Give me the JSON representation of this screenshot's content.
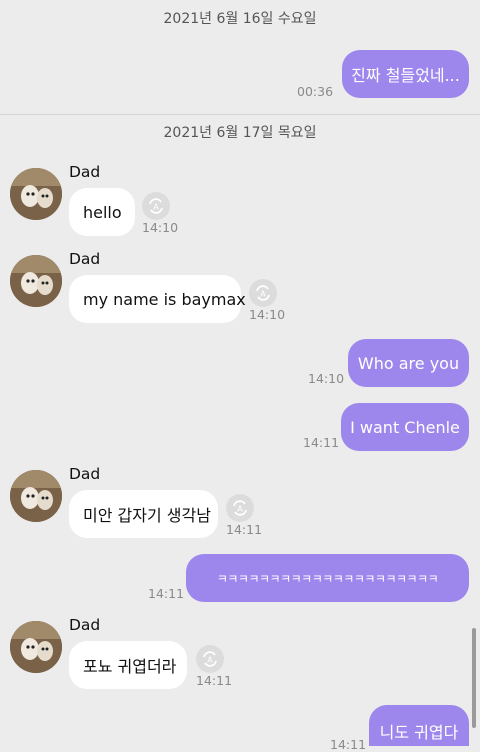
{
  "dates": {
    "d1": "2021년 6월 16일 수요일",
    "d2": "2021년 6월 17일 목요일"
  },
  "sender_name": "Dad",
  "messages": {
    "m1": {
      "text": "진짜 철들었네...",
      "time": "00:36"
    },
    "m2": {
      "text": "hello",
      "time": "14:10"
    },
    "m3": {
      "text": "my name is baymax",
      "time": "14:10"
    },
    "m4": {
      "text": "Who are you",
      "time": "14:10"
    },
    "m5": {
      "text": "I want Chenle",
      "time": "14:11"
    },
    "m6": {
      "text": "미안 갑자기 생각남",
      "time": "14:11"
    },
    "m7": {
      "text": "ㅋㅋㅋㅋㅋㅋㅋㅋㅋㅋㅋㅋㅋㅋㅋㅋㅋㅋㅋㅋㅋ",
      "time": "14:11"
    },
    "m8": {
      "text": "포뇨 귀엽더라",
      "time": "14:11"
    },
    "m9": {
      "text": "니도 귀엽다",
      "time": "14:11"
    }
  },
  "colors": {
    "outgoing_bubble": "#9d87ec",
    "incoming_bubble": "#ffffff",
    "background": "#ececec"
  },
  "icons": {
    "translate": "translate-icon",
    "avatar": "avatar-photo"
  }
}
